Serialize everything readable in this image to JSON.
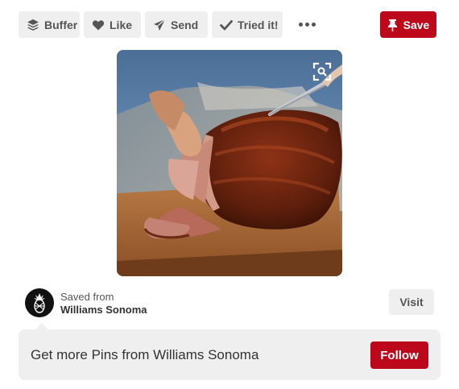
{
  "toolbar": {
    "buffer_label": "Buffer",
    "like_label": "Like",
    "send_label": "Send",
    "tried_label": "Tried it!",
    "save_label": "Save"
  },
  "pin": {
    "image_subject": "sliced glazed ham on wooden cutting board"
  },
  "source": {
    "saved_from_label": "Saved from",
    "name": "Williams Sonoma",
    "visit_label": "Visit"
  },
  "follow": {
    "prompt": "Get more Pins from Williams Sonoma",
    "button_label": "Follow"
  },
  "colors": {
    "brand_red": "#bd081c",
    "button_gray": "#efefef"
  }
}
